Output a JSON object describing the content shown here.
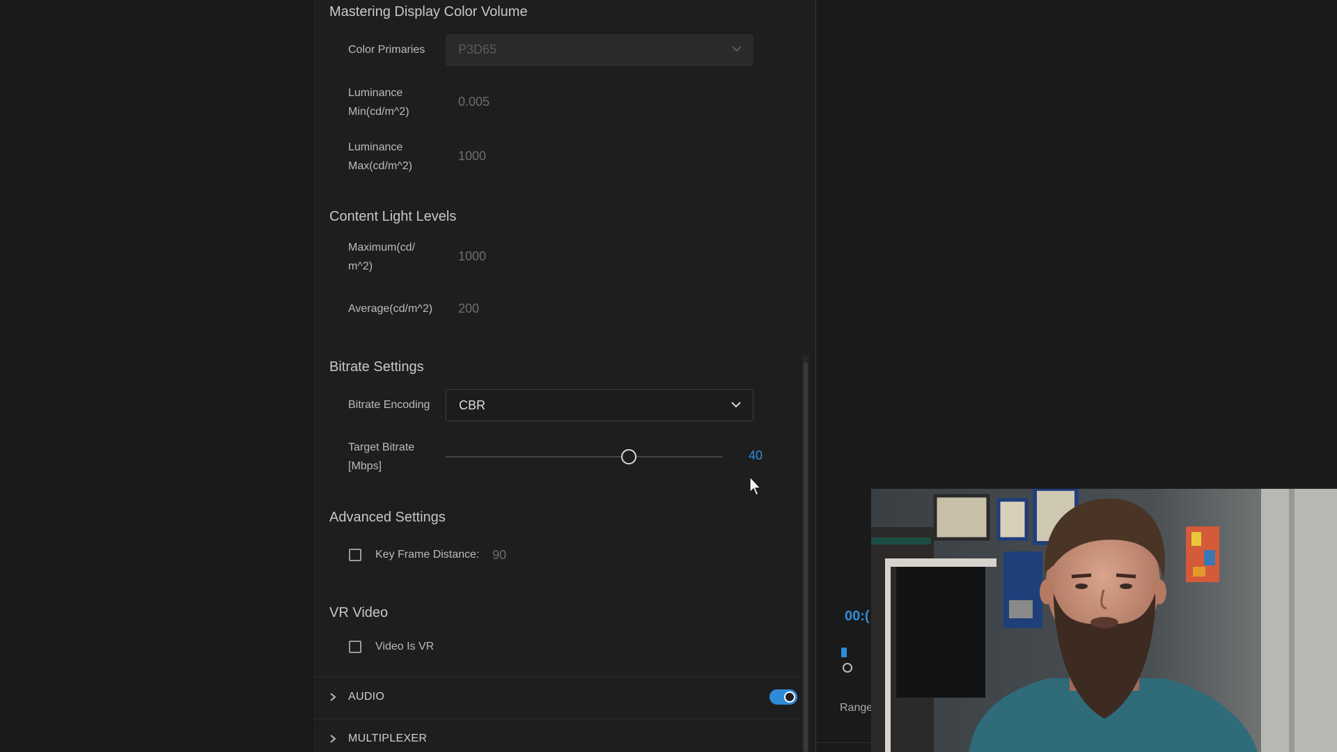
{
  "mastering": {
    "title": "Mastering Display Color Volume",
    "color_primaries_label": "Color Primaries",
    "color_primaries_value": "P3D65",
    "lum_min_label_1": "Luminance",
    "lum_min_label_2": "Min(cd/m^2)",
    "lum_min_value": "0.005",
    "lum_max_label_1": "Luminance",
    "lum_max_label_2": "Max(cd/m^2)",
    "lum_max_value": "1000"
  },
  "content_light": {
    "title": "Content Light Levels",
    "max_label_1": "Maximum(cd/",
    "max_label_2": "m^2)",
    "max_value": "1000",
    "avg_label": "Average(cd/m^2)",
    "avg_value": "200"
  },
  "bitrate": {
    "title": "Bitrate Settings",
    "encoding_label": "Bitrate Encoding",
    "encoding_value": "CBR",
    "target_label_1": "Target Bitrate",
    "target_label_2": "[Mbps]",
    "target_value": "40",
    "target_fraction": 0.66
  },
  "advanced": {
    "title": "Advanced Settings",
    "keyframe_label": "Key Frame Distance:",
    "keyframe_value": "90"
  },
  "vr": {
    "title": "VR Video",
    "video_is_vr_label": "Video Is VR"
  },
  "groups": {
    "audio_label": "AUDIO",
    "audio_enabled": true,
    "multiplexer_label": "MULTIPLEXER"
  },
  "source_panel": {
    "timecode": "00:(",
    "range_label": "Range"
  },
  "colors": {
    "accent": "#2f8bd8",
    "panel_bg": "#1e1e1e",
    "app_bg": "#1a1a1a"
  }
}
